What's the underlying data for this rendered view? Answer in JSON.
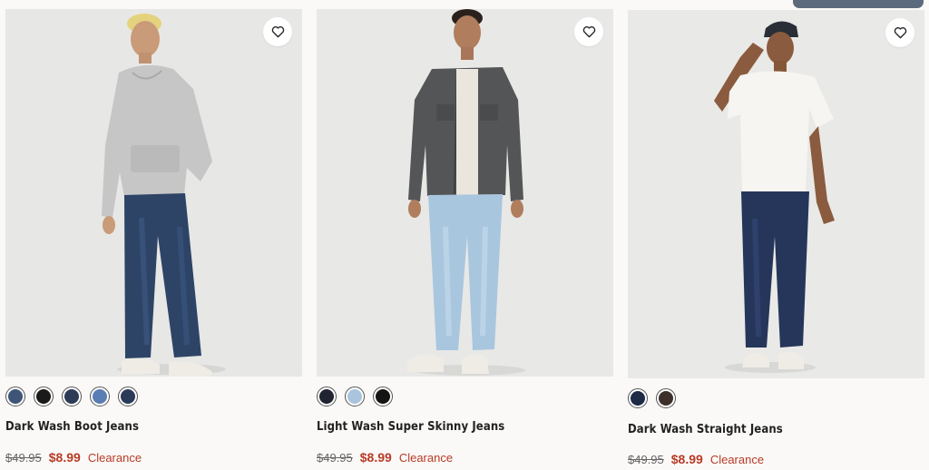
{
  "products": [
    {
      "name": "Dark Wash Boot Jeans",
      "original_price": "$49.95",
      "sale_price": "$8.99",
      "badge": "Clearance",
      "swatch_colors": [
        "#3e5577",
        "#1a1a1a",
        "#2c3a55",
        "#5a7db3",
        "#2b3a58"
      ],
      "wishlist_icon": "heart-outline-icon"
    },
    {
      "name": "Light Wash Super Skinny Jeans",
      "original_price": "$49.95",
      "sale_price": "$8.99",
      "badge": "Clearance",
      "swatch_colors": [
        "#1f2430",
        "#a9c4dc",
        "#141414"
      ],
      "wishlist_icon": "heart-outline-icon"
    },
    {
      "name": "Dark Wash Straight Jeans",
      "original_price": "$49.95",
      "sale_price": "$8.99",
      "badge": "Clearance",
      "swatch_colors": [
        "#1d2b47",
        "#3d302b"
      ],
      "wishlist_icon": "heart-outline-icon"
    }
  ],
  "colors": {
    "sale": "#b83b26",
    "background": "#faf9f7"
  }
}
